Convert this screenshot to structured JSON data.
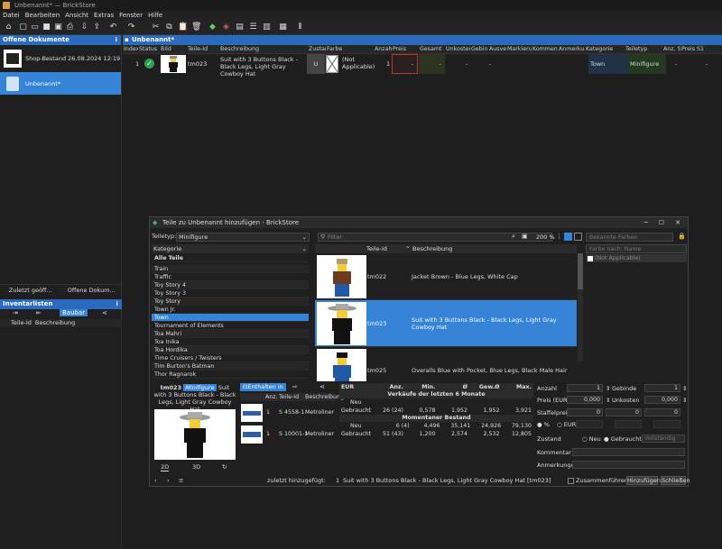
{
  "window": {
    "title": "Unbenannt* — BrickStore"
  },
  "menu": [
    "Datei",
    "Bearbeiten",
    "Ansicht",
    "Extras",
    "Fenster",
    "Hilfe"
  ],
  "left": {
    "header": "Offene Dokumente",
    "docs": [
      {
        "label": "Shop-Bestand 26.08.2024 12:19"
      },
      {
        "label": "Unbenannt*"
      }
    ],
    "buttons": [
      "Zuletzt geöff...",
      "Offene Dokum..."
    ],
    "inv_header": "Inventarlisten",
    "inv_button": "Baubar",
    "inv_cols": [
      "Teile-Id",
      "Beschreibung"
    ]
  },
  "main": {
    "tab": "Unbenannt*",
    "cols": [
      "Index",
      "Status",
      "Bild",
      "Teile-Id",
      "Beschreibung",
      "Zustan",
      "Farbe",
      "Anzahl",
      "Preis",
      "Gesamt",
      "Unkosten",
      "Gebinx",
      "Ausver",
      "Markierung",
      "Kommentar",
      "Anmerkung",
      "Kategorie",
      "Teiletyp",
      "Anz. S",
      "Preis S1"
    ],
    "row": {
      "index": "1",
      "id": "tm023",
      "desc": "Suit with 3 Buttons Black - Black Legs, Light Gray Cowboy Hat",
      "cond": "U",
      "color": "(Not Applicable)",
      "qty": "1",
      "price": "-",
      "total": "-",
      "costs": "-",
      "bulk": "-",
      "category": "Town",
      "type": "Minifigure",
      "tq": "-",
      "tp": "-"
    }
  },
  "dialog": {
    "title": "Teile zu Unbenannt hinzufügen - BrickStore",
    "teiletyp_label": "Teiletyp:",
    "teiletyp": "Minifigure",
    "filter": "Filter",
    "zoom": "200 %",
    "known_colors": "Bekannte Farben",
    "color_filter": "Farbe nach: Name",
    "not_applicable": "(Not Applicable)",
    "cat_header": "Kategorie",
    "categories": [
      "Alle Teile",
      "Train",
      "Traffic",
      "Toy Story 4",
      "Toy Story 3",
      "Toy Story",
      "Town Jr.",
      "Town",
      "Tournament of Elements",
      "Toa Mahri",
      "Toa Inika",
      "Toa Hordika",
      "Time Cruisers / Twisters",
      "Tim Burton's Batman",
      "Thor Ragnarok"
    ],
    "parts_cols": [
      "Teile-Id",
      "Beschreibung"
    ],
    "parts": [
      {
        "id": "tm022",
        "desc": "Jacket Brown - Blue Legs, White Cap"
      },
      {
        "id": "tm023",
        "desc": "Suit with 3 Buttons Black - Black Legs, Light Gray Cowboy Hat"
      },
      {
        "id": "tm025",
        "desc": "Overalls Blue with Pocket, Blue Legs, Black Male Hair"
      }
    ],
    "detail": {
      "id": "tm023",
      "type": "Minifigure",
      "desc": "Suit with 3 Buttons Black - Black Legs, Light Gray Cowboy Hat",
      "view2d": "2D",
      "view3d": "3D"
    },
    "appears": {
      "button": "Enthalten in",
      "cols": [
        "Anz.",
        "Teile-Id",
        "Beschreibung"
      ],
      "rows": [
        {
          "n": "1",
          "id": "S 4558-1",
          "d": "Metroliner"
        },
        {
          "n": "1",
          "id": "S 10001-1",
          "d": "Metroliner"
        }
      ]
    },
    "stats": {
      "cur": "EUR",
      "cols": [
        "Anz.",
        "Min.",
        "Ø",
        "Gew.Ø",
        "Max."
      ],
      "h1": "Verkäufe der letzten 6 Monate",
      "new1": {
        "label": "Neu",
        "vals": [
          "",
          "",
          "",
          "",
          ""
        ]
      },
      "used1": {
        "label": "Gebraucht",
        "vals": [
          "26 (24)",
          "0,578",
          "1,952",
          "1,952",
          "3,921"
        ]
      },
      "h2": "Momentaner Bestand",
      "new2": {
        "label": "Neu",
        "vals": [
          "6 (4)",
          "4,496",
          "35,141",
          "24,926",
          "79,130"
        ]
      },
      "used2": {
        "label": "Gebraucht",
        "vals": [
          "51 (43)",
          "1,200",
          "2,574",
          "2,532",
          "12,805"
        ]
      }
    },
    "form": {
      "anzahl": "Anzahl",
      "anzahl_v": "1",
      "gebinde": "Gebinde",
      "gebinde_v": "1",
      "preis": "Preis (EUR)",
      "preis_v": "0,000",
      "unkosten": "Unkosten",
      "unkosten_v": "0,000",
      "staffel": "Staffelpreise",
      "s1": "0",
      "s2": "0",
      "s3": "0",
      "pct": "%",
      "eur": "EUR",
      "zustand": "Zustand",
      "neu": "Neu",
      "gebraucht": "Gebraucht",
      "vollst": "Vollständig",
      "kommentar": "Kommentar",
      "anmerkungen": "Anmerkungen"
    },
    "status": {
      "prefix": "zuletzt hinzugefügt:",
      "qty": "1",
      "text": "Suit with 3 Buttons Black - Black Legs, Light Gray Cowboy Hat [tm023]"
    },
    "merge": "Zusammenführen",
    "add": "Hinzufügen",
    "close": "Schließen"
  },
  "colors": {
    "accent": "#3584d8",
    "header": "#2a6bbf"
  }
}
